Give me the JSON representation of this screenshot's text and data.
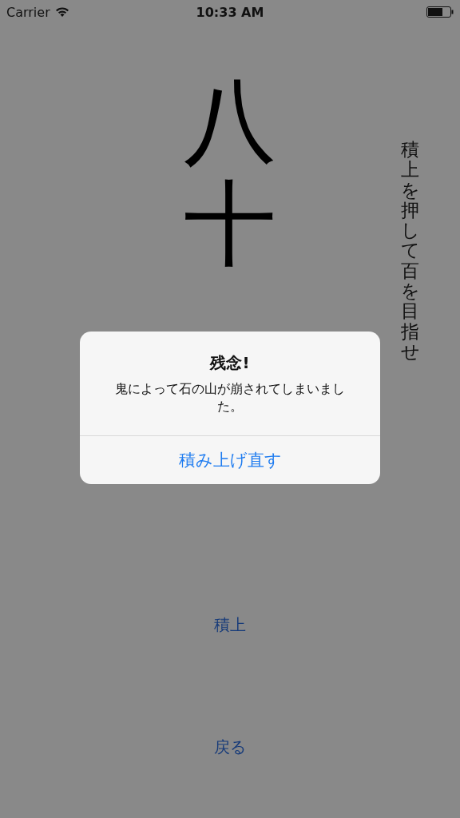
{
  "status_bar": {
    "carrier": "Carrier",
    "time": "10:33 AM"
  },
  "count_text": "八十",
  "instruction": "積上を押して百を目指せ",
  "buttons": [
    {
      "label": "積上"
    },
    {
      "label": "戻る"
    }
  ],
  "alert": {
    "title": "残念!",
    "message": "鬼によって石の山が崩されてしまいました。",
    "button": "積み上げ直す"
  }
}
